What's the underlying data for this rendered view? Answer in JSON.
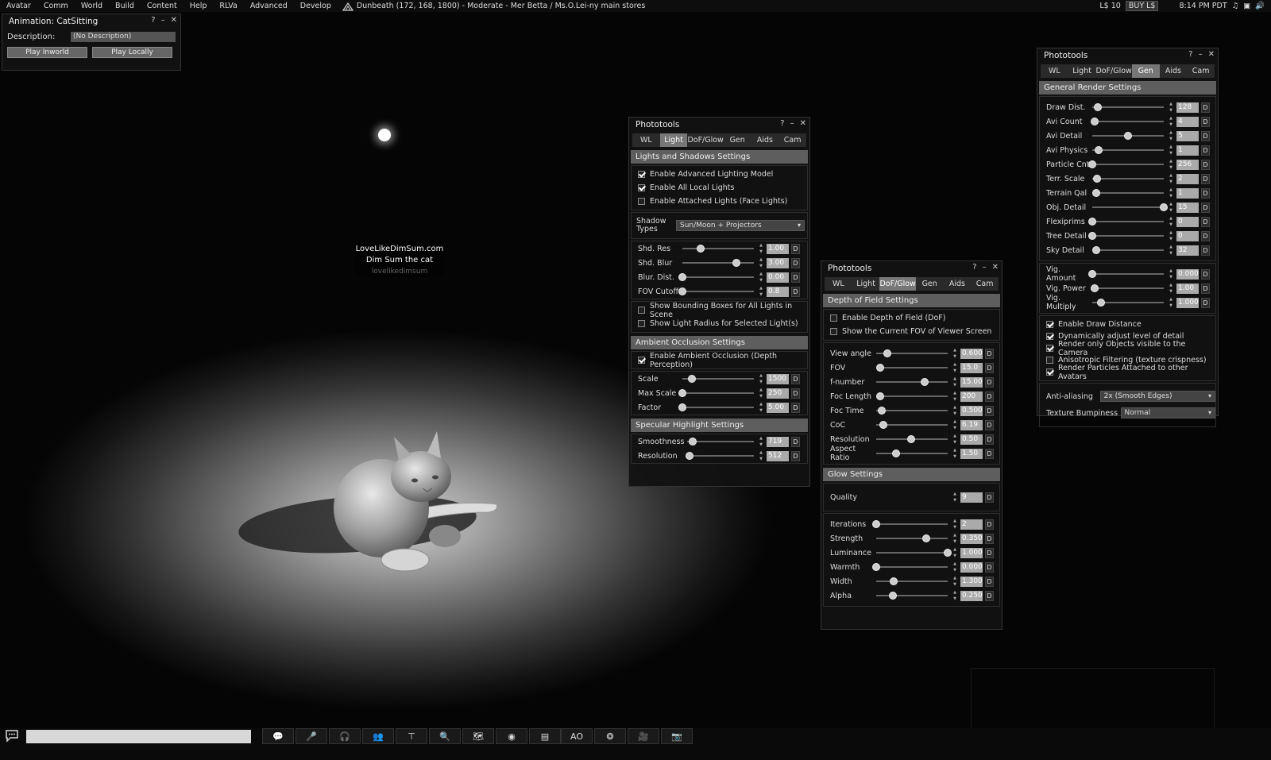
{
  "menu": {
    "items": [
      "Avatar",
      "Comm",
      "World",
      "Build",
      "Content",
      "Help",
      "RLVa",
      "Advanced",
      "Develop"
    ],
    "location": "Dunbeath (172, 168, 1800) - Moderate - Mer Betta / Ms.O.Lei-ny main stores",
    "balance": "L$ 10",
    "buy": "BUY L$",
    "time": "8:14 PM PDT",
    "ghost_name": "Mer Betta"
  },
  "nametag": {
    "line1": "LoveLikeDimSum.com",
    "line2": "Dim Sum the cat",
    "line3": "lovelikedimsum"
  },
  "anim": {
    "title": "Animation: CatSitting",
    "desc_label": "Description:",
    "desc_value": "(No Description)",
    "play_inworld": "Play Inworld",
    "play_locally": "Play Locally"
  },
  "tabs": [
    "WL",
    "Light",
    "DoF/Glow",
    "Gen",
    "Aids",
    "Cam"
  ],
  "light": {
    "title": "Phototools",
    "sect1": "Lights and Shadows Settings",
    "checks": [
      {
        "label": "Enable Advanced Lighting Model",
        "on": true
      },
      {
        "label": "Enable All Local Lights",
        "on": true
      },
      {
        "label": "Enable Attached Lights (Face Lights)",
        "on": false
      }
    ],
    "shadow_label1": "Shadow",
    "shadow_label2": "Types",
    "shadow_value": "Sun/Moon + Projectors",
    "sliders1": [
      {
        "label": "Shd. Res",
        "value": "1.00",
        "frac": 0.25
      },
      {
        "label": "Shd. Blur",
        "value": "3.00",
        "frac": 0.75
      },
      {
        "label": "Blur. Dist.",
        "value": "0.00",
        "frac": 0.0
      },
      {
        "label": "FOV Cutoff",
        "value": "0.8",
        "frac": 0.0
      }
    ],
    "checks2": [
      {
        "label": "Show Bounding Boxes for All Lights in Scene",
        "on": false
      },
      {
        "label": "Show Light Radius for Selected Light(s)",
        "on": false
      }
    ],
    "sect2": "Ambient Occlusion Settings",
    "ao_check": {
      "label": "Enable Ambient Occlusion (Depth Perception)",
      "on": true
    },
    "sliders2": [
      {
        "label": "Scale",
        "value": "1500",
        "frac": 0.13
      },
      {
        "label": "Max Scale",
        "value": "250",
        "frac": 0.0
      },
      {
        "label": "Factor",
        "value": "5.00",
        "frac": 0.0
      }
    ],
    "sect3": "Specular Highlight Settings",
    "sliders3": [
      {
        "label": "Smoothness",
        "value": "719",
        "frac": 0.08
      },
      {
        "label": "Resolution",
        "value": "512",
        "frac": 0.04
      }
    ]
  },
  "dof": {
    "title": "Phototools",
    "sect1": "Depth of Field Settings",
    "checks": [
      {
        "label": "Enable Depth of Field (DoF)",
        "on": false
      },
      {
        "label": "Show the Current FOV of Viewer Screen",
        "on": false
      }
    ],
    "sliders1": [
      {
        "label": "View angle",
        "value": "0.600",
        "frac": 0.15
      },
      {
        "label": "FOV",
        "value": "15.0",
        "frac": 0.06
      },
      {
        "label": "f-number",
        "value": "15.00",
        "frac": 0.68
      },
      {
        "label": "Foc Length",
        "value": "200",
        "frac": 0.06
      },
      {
        "label": "Foc Time",
        "value": "0.500",
        "frac": 0.08
      },
      {
        "label": "CoC",
        "value": "6.19",
        "frac": 0.1
      },
      {
        "label": "Resolution",
        "value": "0.50",
        "frac": 0.49
      },
      {
        "label": "Aspect Ratio",
        "value": "1.50",
        "frac": 0.28
      }
    ],
    "sect2": "Glow Settings",
    "quality_label": "Quality",
    "quality_value": "9",
    "sliders2": [
      {
        "label": "Iterations",
        "value": "2",
        "frac": 0.0
      },
      {
        "label": "Strength",
        "value": "0.350",
        "frac": 0.7
      },
      {
        "label": "Luminance",
        "value": "1.000",
        "frac": 1.0
      },
      {
        "label": "Warmth",
        "value": "0.000",
        "frac": 0.0
      },
      {
        "label": "Width",
        "value": "1.300",
        "frac": 0.24
      },
      {
        "label": "Alpha",
        "value": "0.250",
        "frac": 0.23
      }
    ]
  },
  "gen": {
    "title": "Phototools",
    "sect1": "General Render Settings",
    "sliders1": [
      {
        "label": "Draw Dist.",
        "value": "128",
        "frac": 0.08
      },
      {
        "label": "Avi Count",
        "value": "4",
        "frac": 0.03
      },
      {
        "label": "Avi Detail",
        "value": "5",
        "frac": 0.5
      },
      {
        "label": "Avi Physics",
        "value": "1",
        "frac": 0.09
      },
      {
        "label": "Particle Cnt",
        "value": "256",
        "frac": 0.0
      },
      {
        "label": "Terr. Scale",
        "value": "2",
        "frac": 0.07
      },
      {
        "label": "Terrain Qal",
        "value": "1",
        "frac": 0.05
      },
      {
        "label": "Obj. Detail",
        "value": "15",
        "frac": 1.0
      },
      {
        "label": "Flexiprims",
        "value": "0",
        "frac": 0.0
      },
      {
        "label": "Tree Detail",
        "value": "0",
        "frac": 0.0
      },
      {
        "label": "Sky Detail",
        "value": "32",
        "frac": 0.05
      }
    ],
    "sliders2": [
      {
        "label": "Vig. Amount",
        "value": "0.000",
        "frac": 0.0
      },
      {
        "label": "Vig. Power",
        "value": "1.00",
        "frac": 0.03
      },
      {
        "label": "Vig. Multiply",
        "value": "1.000",
        "frac": 0.12
      }
    ],
    "checks": [
      {
        "label": "Enable Draw Distance",
        "on": true
      },
      {
        "label": "Dynamically adjust level of detail",
        "on": true
      },
      {
        "label": "Render only Objects visible to the Camera",
        "on": true
      },
      {
        "label": "Anisotropic Filtering (texture crispness)",
        "on": false
      },
      {
        "label": "Render Particles Attached to other Avatars",
        "on": true
      }
    ],
    "aa_label": "Anti-aliasing",
    "aa_value": "2x (Smooth Edges)",
    "tb_label": "Texture Bumpiness",
    "tb_value": "Normal"
  },
  "toolbar": {
    "ao": "AO"
  }
}
